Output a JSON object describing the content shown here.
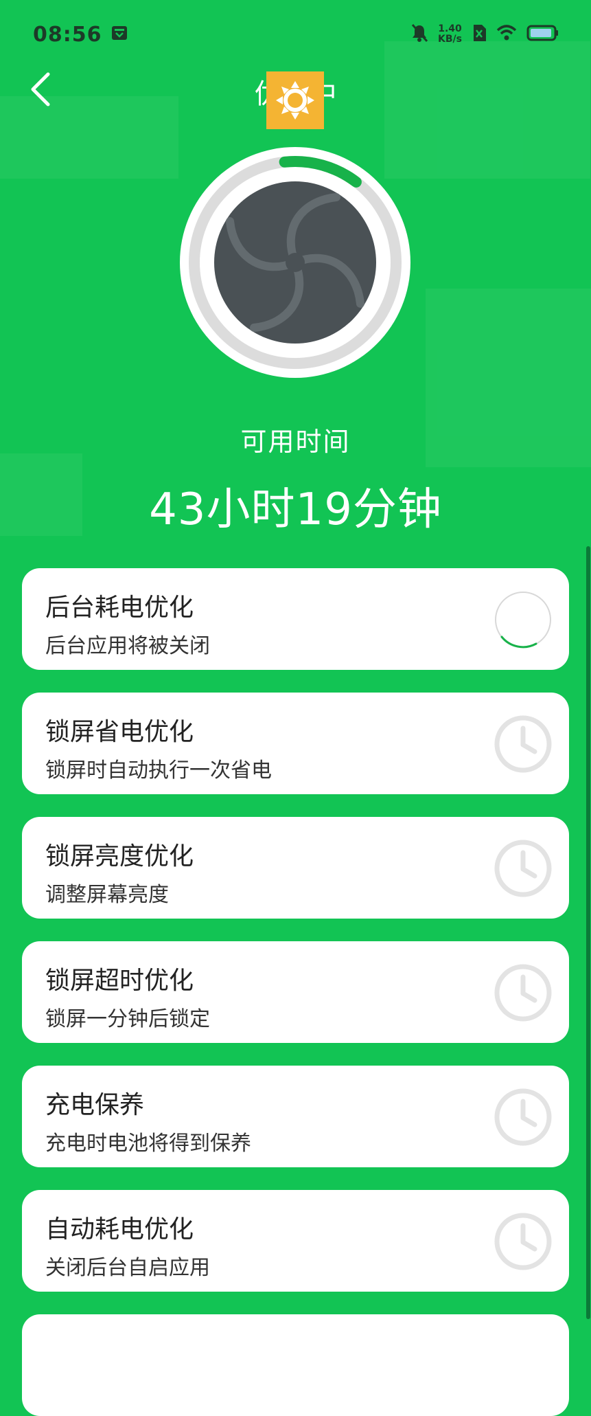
{
  "status_bar": {
    "time": "08:56",
    "net_speed_value": "1.40",
    "net_speed_unit": "KB/s"
  },
  "header": {
    "title": "优化中"
  },
  "summary": {
    "label": "可用时间",
    "time": "43小时19分钟",
    "progress": 0.12
  },
  "colors": {
    "background": "#12c454",
    "accent_green": "#18b24a",
    "card": "#ffffff",
    "brightness_overlay": "#f4b433"
  },
  "items": [
    {
      "title": "后台耗电优化",
      "subtitle": "后台应用将被关闭",
      "icon": "spinner-icon",
      "status": "in-progress"
    },
    {
      "title": "锁屏省电优化",
      "subtitle": "锁屏时自动执行一次省电",
      "icon": "clock-icon",
      "status": "pending"
    },
    {
      "title": "锁屏亮度优化",
      "subtitle": "调整屏幕亮度",
      "icon": "clock-icon",
      "status": "pending"
    },
    {
      "title": "锁屏超时优化",
      "subtitle": "锁屏一分钟后锁定",
      "icon": "clock-icon",
      "status": "pending"
    },
    {
      "title": "充电保养",
      "subtitle": "充电时电池将得到保养",
      "icon": "clock-icon",
      "status": "pending"
    },
    {
      "title": "自动耗电优化",
      "subtitle": "关闭后台自启应用",
      "icon": "clock-icon",
      "status": "pending"
    }
  ]
}
